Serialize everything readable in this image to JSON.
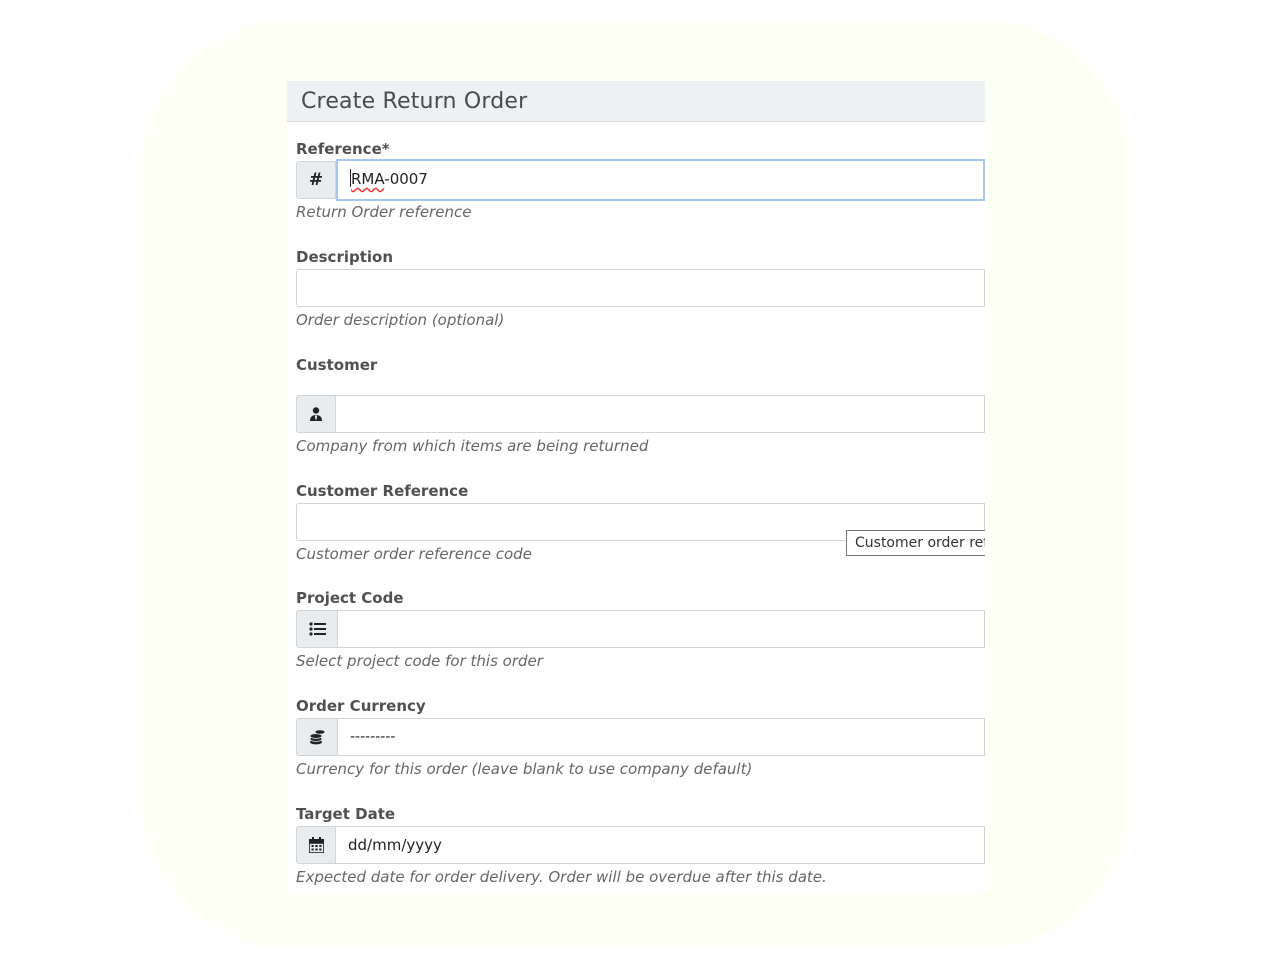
{
  "dialog": {
    "title": "Create Return Order"
  },
  "fields": {
    "reference": {
      "label": "Reference*",
      "value_prefix": "RMA",
      "value_suffix": "-0007",
      "help": "Return Order reference",
      "icon": "hash-icon"
    },
    "description": {
      "label": "Description",
      "value": "",
      "help": "Order description (optional)"
    },
    "customer": {
      "label": "Customer",
      "value": "",
      "help": "Company from which items are being returned",
      "icon": "user-tie-icon"
    },
    "customer_reference": {
      "label": "Customer Reference",
      "value": "",
      "help": "Customer order reference code",
      "tooltip": "Customer order reference code"
    },
    "project_code": {
      "label": "Project Code",
      "value": "",
      "help": "Select project code for this order",
      "icon": "list-icon"
    },
    "order_currency": {
      "label": "Order Currency",
      "value": "---------",
      "help": "Currency for this order (leave blank to use company default)",
      "icon": "coins-icon"
    },
    "target_date": {
      "label": "Target Date",
      "value": "dd/mm/yyyy",
      "help": "Expected date for order delivery. Order will be overdue after this date.",
      "icon": "calendar-icon"
    }
  },
  "colors": {
    "background_blob": "#fefff5",
    "header_bg": "#eef1f4",
    "focus_border": "#a9c6ee",
    "addon_bg": "#e9ecef"
  }
}
